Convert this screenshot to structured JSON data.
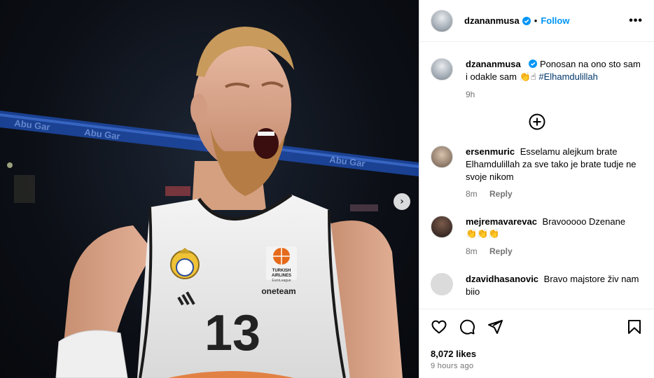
{
  "post": {
    "username": "dzananmusa",
    "follow_label": "Follow",
    "separator": "•",
    "more_label": "•••",
    "media_next_label": "›",
    "jersey": {
      "number": "13",
      "sponsor": "oneteam",
      "league_line1": "TURKISH",
      "league_line2": "AIRLINES",
      "league_line3": "EuroLeague"
    }
  },
  "caption": {
    "username": "dzananmusa",
    "text": "Ponosan na ono sto sam i odakle sam",
    "emoji": "👏☝",
    "hashtag": "#Elhamdulillah",
    "time": "9h"
  },
  "comments": [
    {
      "username": "ersenmuric",
      "text": "Esselamu alejkum brate Elhamdulillah za sve tako je brate tudje ne svoje nikom",
      "time": "8m",
      "reply_label": "Reply"
    },
    {
      "username": "mejremavarevac",
      "text": "Bravooooo Dzenane",
      "emoji": "👏👏👏",
      "time": "8m",
      "reply_label": "Reply"
    },
    {
      "username": "dzavidhasanovic",
      "text": "Bravo majstore živ nam biio",
      "time": "",
      "reply_label": ""
    }
  ],
  "footer": {
    "likes": "8,072 likes",
    "time_ago": "9 hours ago"
  },
  "icons": {
    "verified": "verified-badge-icon",
    "load_more": "plus-circle-icon",
    "like": "heart-icon",
    "comment": "comment-icon",
    "share": "send-icon",
    "save": "bookmark-icon"
  },
  "colors": {
    "accent": "#0095f6",
    "hashtag": "#00376b",
    "muted": "#737373",
    "border": "#dbdbdb",
    "jersey_trim": "#1a1a1a"
  }
}
